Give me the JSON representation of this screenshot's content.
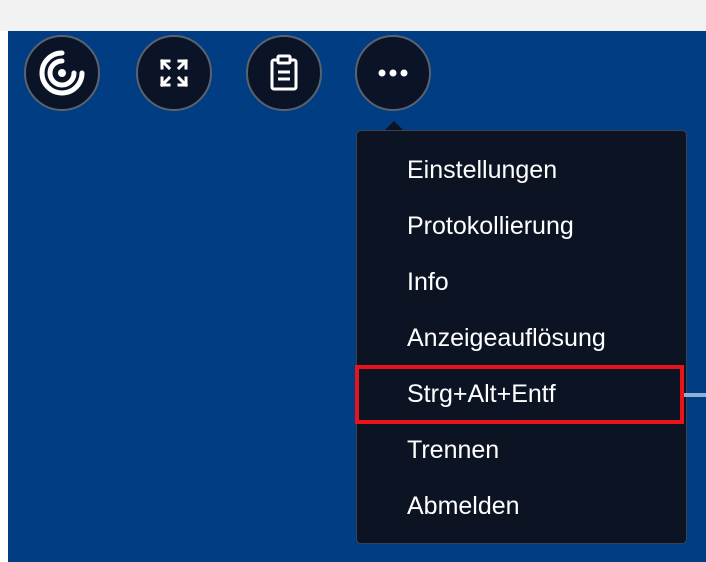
{
  "toolbar": {
    "buttons": [
      {
        "icon": "citrix-logo-icon"
      },
      {
        "icon": "fullscreen-icon"
      },
      {
        "icon": "clipboard-icon"
      },
      {
        "icon": "more-icon"
      }
    ]
  },
  "menu": {
    "items": [
      {
        "label": "Einstellungen"
      },
      {
        "label": "Protokollierung"
      },
      {
        "label": "Info"
      },
      {
        "label": "Anzeigeauflösung"
      },
      {
        "label": "Strg+Alt+Entf",
        "highlighted": true
      },
      {
        "label": "Trennen"
      },
      {
        "label": "Abmelden"
      }
    ]
  },
  "colors": {
    "desktop_background": "#003d82",
    "menu_background": "#0c1424",
    "highlight_border": "#e8141b",
    "text": "#ffffff"
  }
}
